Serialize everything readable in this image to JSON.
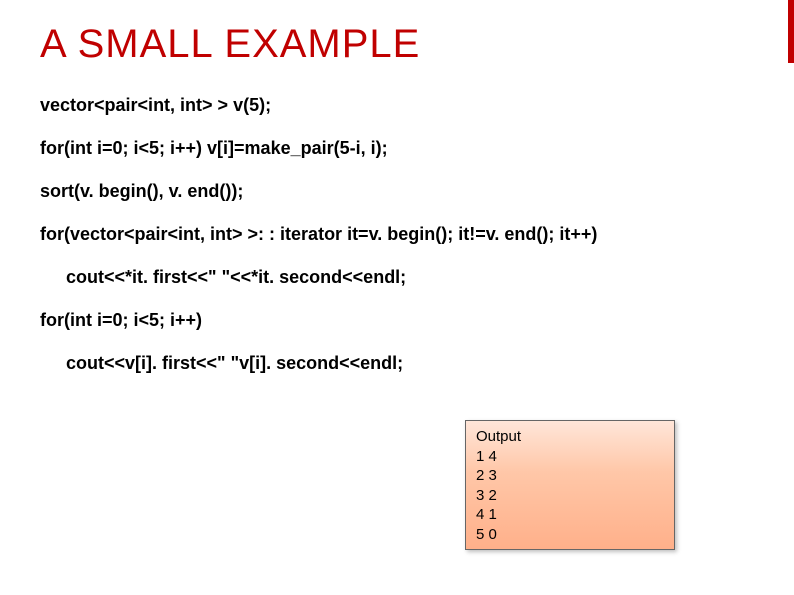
{
  "title": "A SMALL EXAMPLE",
  "code": {
    "l1": "vector<pair<int, int> > v(5);",
    "l2": "for(int i=0; i<5; i++) v[i]=make_pair(5-i, i);",
    "l3": "sort(v. begin(), v. end());",
    "l4": "for(vector<pair<int, int> >: : iterator it=v. begin(); it!=v. end(); it++)",
    "l5": "cout<<*it. first<<\" \"<<*it. second<<endl;",
    "l6": "for(int i=0; i<5; i++)",
    "l7": "cout<<v[i]. first<<\" \"v[i]. second<<endl;"
  },
  "output": {
    "label": "Output",
    "rows": [
      "1 4",
      "2 3",
      "3 2",
      "4 1",
      "5 0"
    ]
  },
  "colors": {
    "accent": "#c00000"
  }
}
